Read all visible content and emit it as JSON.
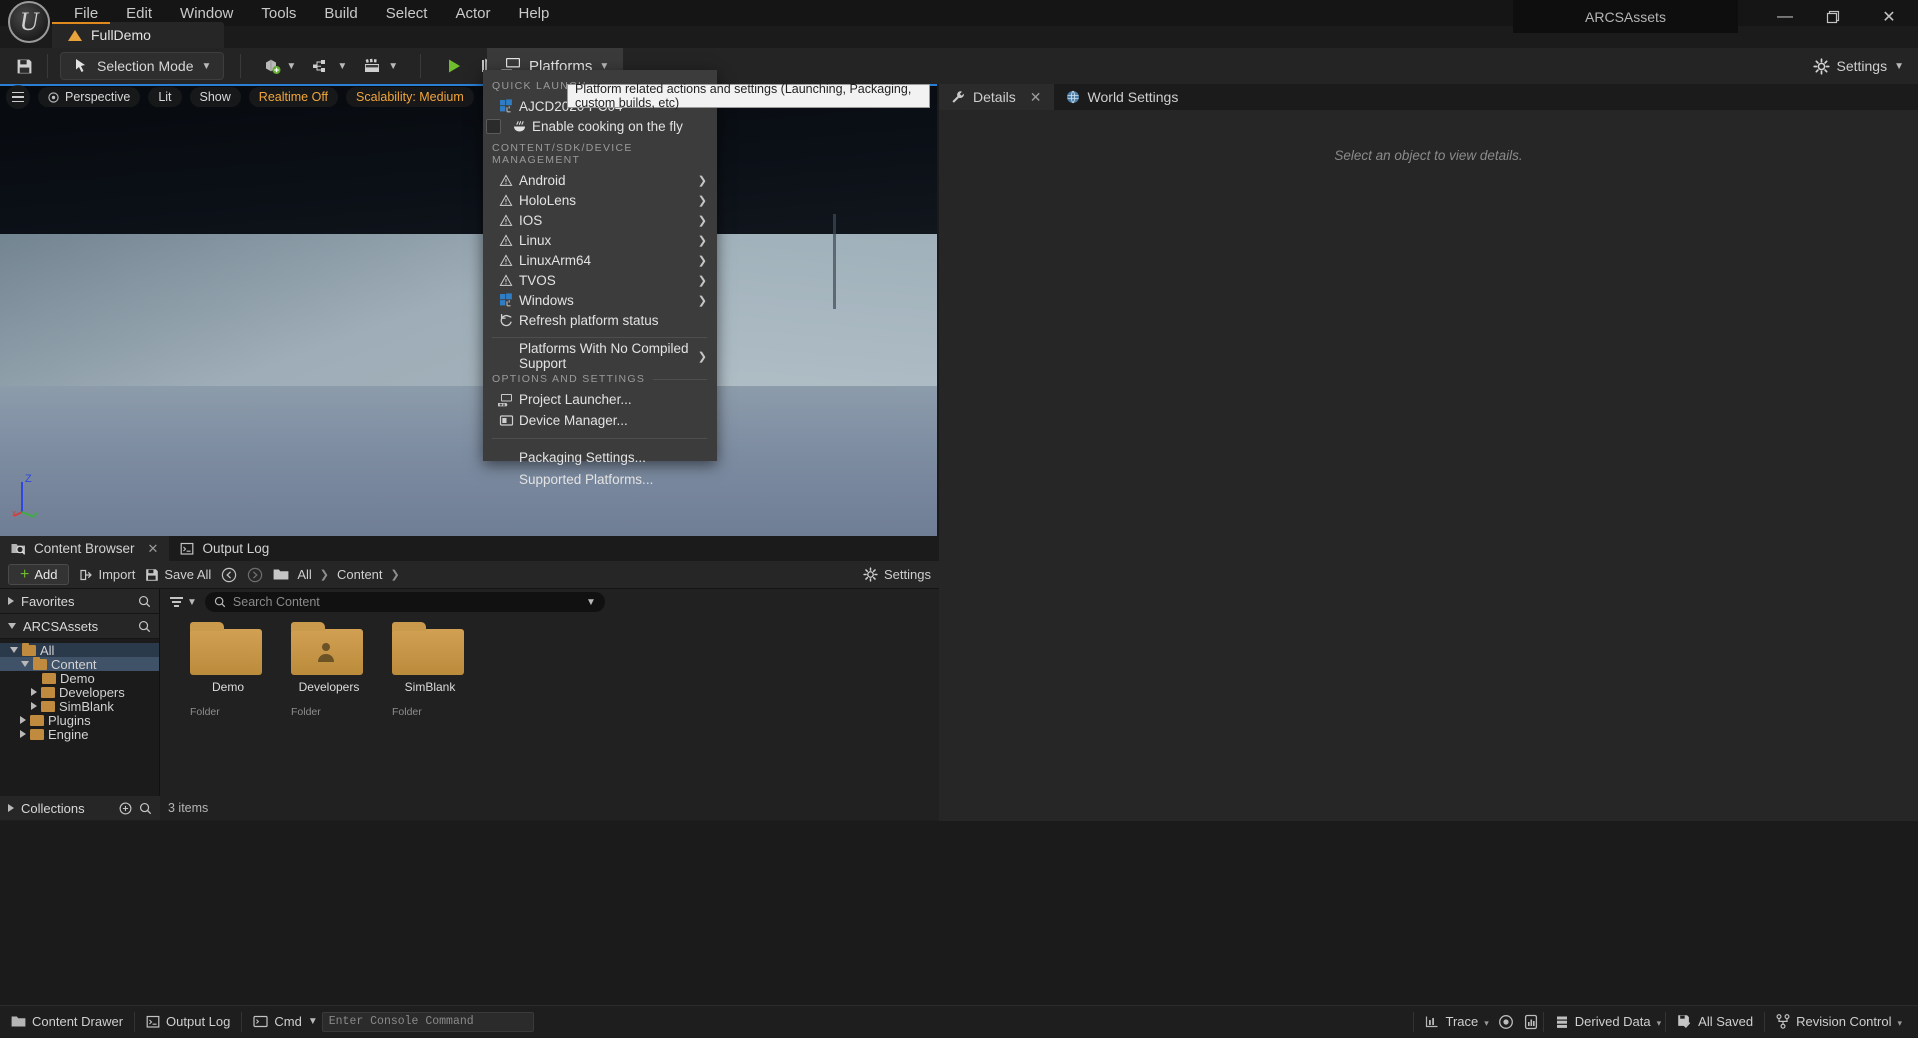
{
  "app": {
    "window_title": "ARCSAssets",
    "project_tab": "FullDemo"
  },
  "menubar": {
    "items": [
      {
        "label": "File"
      },
      {
        "label": "Edit"
      },
      {
        "label": "Window"
      },
      {
        "label": "Tools"
      },
      {
        "label": "Build"
      },
      {
        "label": "Select"
      },
      {
        "label": "Actor"
      },
      {
        "label": "Help"
      }
    ]
  },
  "window_controls": {
    "minimize": "—",
    "maximize": "❐",
    "close": "✕"
  },
  "toolbar": {
    "save_icon": "save-icon",
    "selection_mode": "Selection Mode",
    "platforms": "Platforms",
    "settings": "Settings",
    "play": "play-button",
    "skip": "skip-button",
    "stop": "stop-button",
    "eject": "eject-button",
    "more": "more-options-button"
  },
  "viewport": {
    "perspective": "Perspective",
    "lit": "Lit",
    "show": "Show",
    "realtime": "Realtime Off",
    "scalability": "Scalability: Medium",
    "axis_z": "Z",
    "axis_x": "x",
    "axis_y": "y"
  },
  "tooltip": {
    "text": "Platform related actions and settings (Launching, Packaging, custom builds, etc)"
  },
  "platforms_menu": {
    "quick_launch_header": "QUICK LAUNCH",
    "quick_launch": [
      {
        "label": "AJCD2020-PC04",
        "icon": "windows-icon"
      },
      {
        "label": "Enable cooking on the fly",
        "icon": "cook-icon",
        "checkbox": true
      }
    ],
    "sdk_header": "CONTENT/SDK/DEVICE MANAGEMENT",
    "platforms": [
      {
        "label": "Android",
        "icon": "warning-icon",
        "submenu": true
      },
      {
        "label": "HoloLens",
        "icon": "warning-icon",
        "submenu": true
      },
      {
        "label": "IOS",
        "icon": "warning-icon",
        "submenu": true
      },
      {
        "label": "Linux",
        "icon": "warning-icon",
        "submenu": true
      },
      {
        "label": "LinuxArm64",
        "icon": "warning-icon",
        "submenu": true
      },
      {
        "label": "TVOS",
        "icon": "warning-icon",
        "submenu": true
      },
      {
        "label": "Windows",
        "icon": "windows-icon",
        "submenu": true
      },
      {
        "label": "Refresh platform status",
        "icon": "refresh-icon",
        "submenu": false
      }
    ],
    "no_compiled_support": {
      "label": "Platforms With No Compiled Support",
      "submenu": true
    },
    "options_header": "OPTIONS AND SETTINGS",
    "options": [
      {
        "label": "Project Launcher...",
        "icon": "launcher-icon"
      },
      {
        "label": "Device Manager...",
        "icon": "device-icon"
      }
    ],
    "footer": [
      {
        "label": "Packaging Settings..."
      },
      {
        "label": "Supported Platforms..."
      }
    ]
  },
  "details_panel": {
    "tabs": [
      {
        "label": "Details",
        "icon": "wrench-icon",
        "active": true,
        "closable": true
      },
      {
        "label": "World Settings",
        "icon": "globe-icon",
        "active": false,
        "closable": false
      }
    ],
    "empty_message": "Select an object to view details."
  },
  "content_browser": {
    "tabs": [
      {
        "label": "Content Browser",
        "icon": "content-browser-icon",
        "active": true,
        "closable": true
      },
      {
        "label": "Output Log",
        "icon": "output-log-icon",
        "active": false,
        "closable": false
      }
    ],
    "toolbar": {
      "add": "Add",
      "import": "Import",
      "save_all": "Save All",
      "settings": "Settings",
      "breadcrumbs": [
        "All",
        "Content"
      ]
    },
    "sections": [
      {
        "label": "Favorites",
        "expanded": false
      },
      {
        "label": "ARCSAssets",
        "expanded": true
      }
    ],
    "tree": [
      {
        "label": "All",
        "depth": 0,
        "expanded": true,
        "selected": false,
        "highlight": true
      },
      {
        "label": "Content",
        "depth": 1,
        "expanded": true,
        "selected": true,
        "highlight": false
      },
      {
        "label": "Demo",
        "depth": 2,
        "expanded": false,
        "arrow": false
      },
      {
        "label": "Developers",
        "depth": 2,
        "expanded": false,
        "arrow": true
      },
      {
        "label": "SimBlank",
        "depth": 2,
        "expanded": false,
        "arrow": true
      },
      {
        "label": "Plugins",
        "depth": 1,
        "expanded": false,
        "arrow": true
      },
      {
        "label": "Engine",
        "depth": 1,
        "expanded": false,
        "arrow": true
      }
    ],
    "collections": "Collections",
    "search_placeholder": "Search Content",
    "assets": [
      {
        "name": "Demo",
        "type": "Folder",
        "kind": "folder"
      },
      {
        "name": "Developers",
        "type": "Folder",
        "kind": "developers"
      },
      {
        "name": "SimBlank",
        "type": "Folder",
        "kind": "folder"
      }
    ],
    "item_count": "3 items"
  },
  "statusbar": {
    "content_drawer": "Content Drawer",
    "output_log": "Output Log",
    "cmd": "Cmd",
    "console_placeholder": "Enter Console Command",
    "trace": "Trace",
    "derived_data": "Derived Data",
    "all_saved": "All Saved",
    "revision_control": "Revision Control"
  },
  "colors": {
    "accent_orange": "#e08a1e",
    "selection_blue": "#3f5268",
    "folder_gold": "#c08b3e",
    "viewport_top_line": "#2a7fd4",
    "play_green": "#6fbd2f"
  }
}
